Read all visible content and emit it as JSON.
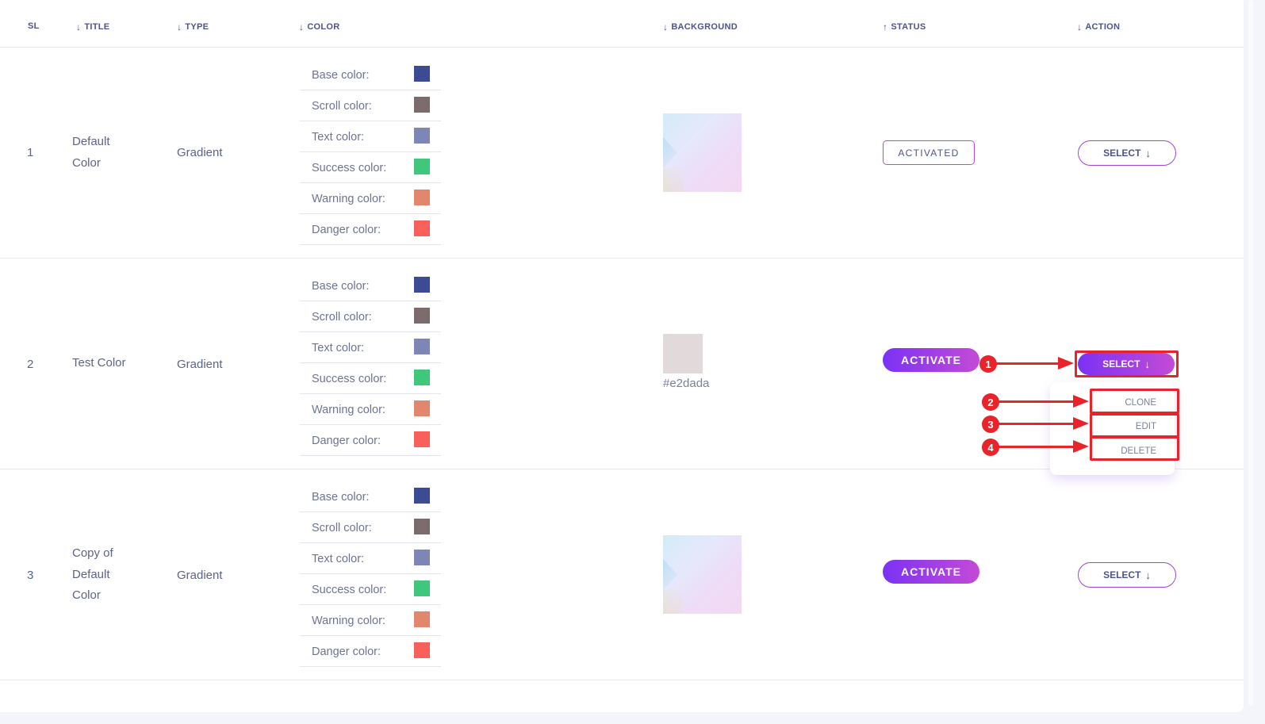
{
  "headers": {
    "sl": "SL",
    "title": "TITLE",
    "type": "TYPE",
    "color": "COLOR",
    "background": "BACKGROUND",
    "status": "STATUS",
    "action": "ACTION"
  },
  "sort_icons": {
    "down": "↓",
    "up": "↑"
  },
  "color_labels": [
    "Base color:",
    "Scroll color:",
    "Text color:",
    "Success color:",
    "Warning color:",
    "Danger color:"
  ],
  "swatch_colors": [
    "#3c4b93",
    "#7c6c6e",
    "#7d86b4",
    "#3fc87c",
    "#e2876d",
    "#f9605b"
  ],
  "rows": [
    {
      "sl": "1",
      "title_lines": [
        "Default",
        "Color"
      ],
      "type": "Gradient",
      "background": {
        "kind": "gradient-image"
      },
      "status": "ACTIVATED",
      "action": "SELECT"
    },
    {
      "sl": "2",
      "title_lines": [
        "Test Color"
      ],
      "type": "Gradient",
      "background": {
        "kind": "solid",
        "color": "#e2dada",
        "hex_label": "#e2dada"
      },
      "status": "ACTIVATE",
      "action": "SELECT"
    },
    {
      "sl": "3",
      "title_lines": [
        "Copy of",
        "Default",
        "Color"
      ],
      "type": "Gradient",
      "background": {
        "kind": "gradient-image"
      },
      "status": "ACTIVATE",
      "action": "SELECT"
    }
  ],
  "dropdown": {
    "items": [
      "CLONE",
      "EDIT",
      "DELETE"
    ]
  },
  "annotations": [
    "1",
    "2",
    "3",
    "4"
  ],
  "colors": {
    "accent_start": "#7b32f5",
    "accent_end": "#c44ad6",
    "annotation_red": "#e8242a"
  }
}
